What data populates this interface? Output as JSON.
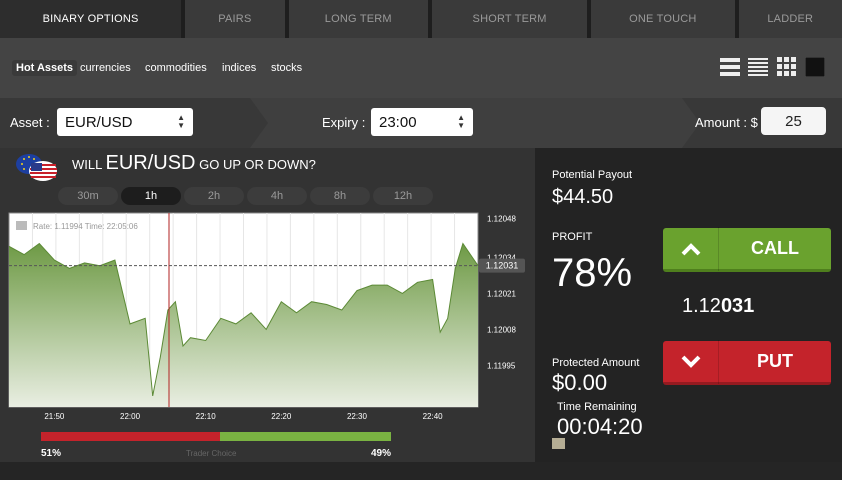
{
  "tabs": [
    {
      "label": "BINARY OPTIONS",
      "active": true
    },
    {
      "label": "PAIRS"
    },
    {
      "label": "LONG TERM"
    },
    {
      "label": "SHORT TERM"
    },
    {
      "label": "ONE TOUCH"
    },
    {
      "label": "LADDER"
    }
  ],
  "categories": [
    {
      "label": "Hot Assets",
      "active": true
    },
    {
      "label": "currencies"
    },
    {
      "label": "commodities"
    },
    {
      "label": "indices"
    },
    {
      "label": "stocks"
    }
  ],
  "view_icons": [
    "list-view-icon",
    "compact-list-icon",
    "grid-view-icon",
    "single-view-icon"
  ],
  "selection": {
    "asset_label": "Asset :",
    "asset_value": "EUR/USD",
    "expiry_label": "Expiry :",
    "expiry_value": "23:00",
    "amount_label": "Amount : $",
    "amount_value": "25"
  },
  "question": {
    "prefix": "WILL",
    "asset": "EUR/USD",
    "suffix": "GO UP OR DOWN?"
  },
  "timeframes": [
    {
      "label": "30m"
    },
    {
      "label": "1h",
      "active": true
    },
    {
      "label": "2h"
    },
    {
      "label": "4h"
    },
    {
      "label": "8h"
    },
    {
      "label": "12h"
    }
  ],
  "chart_data": {
    "type": "area",
    "tooltip": "Rate: 1.11994 Time: 22:05:06",
    "x_ticks": [
      "21:50",
      "22:00",
      "22:10",
      "22:20",
      "22:30",
      "22:40"
    ],
    "y_ticks": [
      "1.12048",
      "1.12034",
      "1.12021",
      "1.12008",
      "1.11995"
    ],
    "current_rate_label": "1.12031",
    "ylim": [
      1.1198,
      1.1205
    ],
    "series": [
      {
        "x": [
          "21:44",
          "21:46",
          "21:48",
          "21:50",
          "21:52",
          "21:54",
          "21:56",
          "21:58",
          "22:00",
          "22:02",
          "22:03",
          "22:04",
          "22:05",
          "22:06",
          "22:07",
          "22:08",
          "22:10",
          "22:12",
          "22:14",
          "22:16",
          "22:18",
          "22:20",
          "22:22",
          "22:24",
          "22:26",
          "22:28",
          "22:30",
          "22:32",
          "22:34",
          "22:36",
          "22:38",
          "22:40",
          "22:41",
          "22:42",
          "22:43",
          "22:44",
          "22:46"
        ],
        "values": [
          1.12038,
          1.12035,
          1.12039,
          1.12033,
          1.1203,
          1.12032,
          1.12031,
          1.12033,
          1.1201,
          1.12012,
          1.11984,
          1.11998,
          1.12015,
          1.12018,
          1.12002,
          1.12005,
          1.12004,
          1.12012,
          1.1201,
          1.12014,
          1.12008,
          1.12018,
          1.12014,
          1.12018,
          1.12017,
          1.12015,
          1.12022,
          1.12024,
          1.12024,
          1.12021,
          1.12025,
          1.12026,
          1.12007,
          1.12012,
          1.1203,
          1.12039,
          1.12031
        ]
      }
    ]
  },
  "sentiment": {
    "up_percent": "51%",
    "down_percent": "49%",
    "label": "Trader Choice",
    "up_fraction": 0.51
  },
  "trade": {
    "payout_label": "Potential Payout",
    "payout_value": "$44.50",
    "profit_label": "PROFIT",
    "profit_value": "78%",
    "call_label": "CALL",
    "put_label": "PUT",
    "rate_prefix": "1.12",
    "rate_bold": "031",
    "protected_label": "Protected Amount",
    "protected_value": "$0.00",
    "time_label": "Time Remaining",
    "time_value": "00:04:20"
  },
  "colors": {
    "call": "#6aa22e",
    "put": "#c4232b",
    "area": "#6e9a45"
  }
}
